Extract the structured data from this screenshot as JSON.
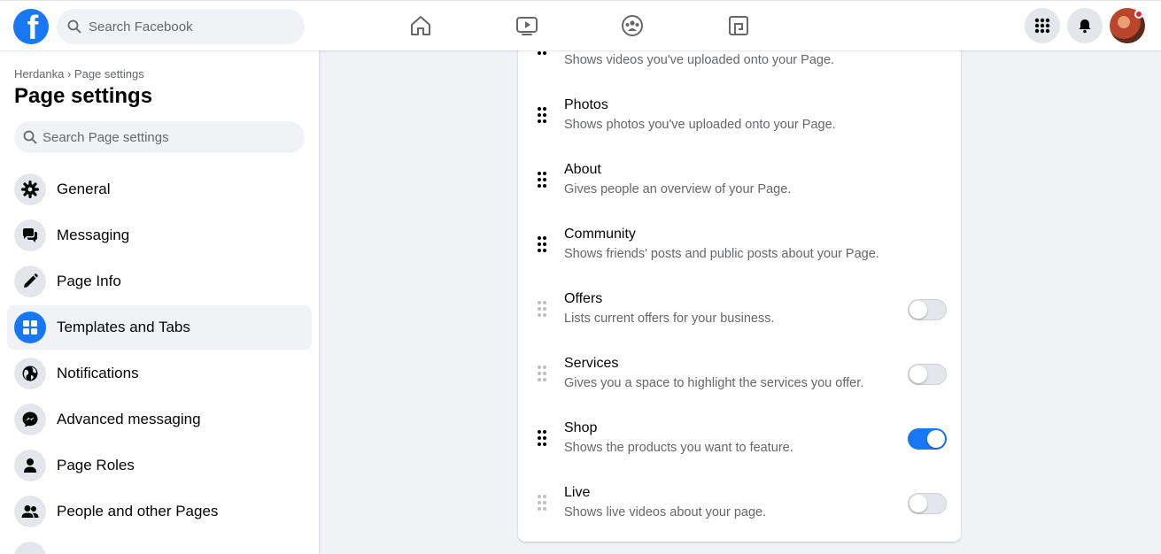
{
  "header": {
    "logo_letter": "f",
    "search_placeholder": "Search Facebook",
    "nav_icons": [
      "home-icon",
      "watch-icon",
      "groups-icon",
      "gaming-icon"
    ],
    "right_icons": [
      "menu-grid-icon",
      "notifications-bell-icon",
      "profile-avatar"
    ]
  },
  "sidebar": {
    "breadcrumb": "Herdanka › Page settings",
    "title": "Page settings",
    "search_placeholder": "Search Page settings",
    "items": [
      {
        "label": "General",
        "icon": "gear-icon",
        "active": false
      },
      {
        "label": "Messaging",
        "icon": "messaging-icon",
        "active": false
      },
      {
        "label": "Page Info",
        "icon": "pencil-icon",
        "active": false
      },
      {
        "label": "Templates and Tabs",
        "icon": "grid-icon",
        "active": true
      },
      {
        "label": "Notifications",
        "icon": "globe-icon",
        "active": false
      },
      {
        "label": "Advanced messaging",
        "icon": "messenger-icon",
        "active": false
      },
      {
        "label": "Page Roles",
        "icon": "person-icon",
        "active": false
      },
      {
        "label": "People and other Pages",
        "icon": "people-icon",
        "active": false
      }
    ]
  },
  "tabs": {
    "partial_desc": "Shows videos you've uploaded onto your Page.",
    "items": [
      {
        "title": "Photos",
        "desc": "Shows photos you've uploaded onto your Page.",
        "toggle": null,
        "enabled": true
      },
      {
        "title": "About",
        "desc": "Gives people an overview of your Page.",
        "toggle": null,
        "enabled": true
      },
      {
        "title": "Community",
        "desc": "Shows friends' posts and public posts about your Page.",
        "toggle": null,
        "enabled": true
      },
      {
        "title": "Offers",
        "desc": "Lists current offers for your business.",
        "toggle": false,
        "enabled": false
      },
      {
        "title": "Services",
        "desc": "Gives you a space to highlight the services you offer.",
        "toggle": false,
        "enabled": false
      },
      {
        "title": "Shop",
        "desc": "Shows the products you want to feature.",
        "toggle": true,
        "enabled": true
      },
      {
        "title": "Live",
        "desc": "Shows live videos about your page.",
        "toggle": false,
        "enabled": false
      }
    ]
  },
  "colors": {
    "accent": "#1877f2",
    "background": "#f0f2f5",
    "text_secondary": "#65676b"
  }
}
